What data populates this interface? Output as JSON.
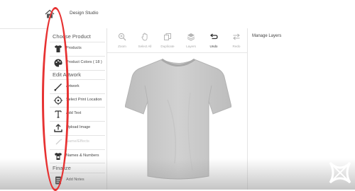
{
  "header": {
    "title": "Design Studio",
    "home_icon": "home-icon"
  },
  "sidebar": {
    "sections": {
      "choose_product": "Choose Product",
      "edit_artwork": "Edit Artwork",
      "finalize": "Finalize"
    },
    "items": [
      {
        "label": "Products",
        "icon": "tshirt-icon",
        "enabled": true
      },
      {
        "label": "Product Colors ( 18 )",
        "icon": "palette-icon",
        "enabled": true
      },
      {
        "label": "Artwork",
        "icon": "brush-icon",
        "enabled": true
      },
      {
        "label": "Select Print Location",
        "icon": "location-icon",
        "enabled": true
      },
      {
        "label": "Add Text",
        "icon": "text-icon",
        "enabled": true
      },
      {
        "label": "Upload Image",
        "icon": "upload-icon",
        "enabled": true
      },
      {
        "label": "Name/Effects",
        "icon": "magic-wand-icon",
        "enabled": false
      },
      {
        "label": "Names & Numbers",
        "icon": "jersey-icon",
        "enabled": true
      },
      {
        "label": "Add Notes",
        "icon": "notes-icon",
        "enabled": true
      }
    ]
  },
  "toolbar": {
    "tools": [
      {
        "label": "Zoom",
        "icon": "zoom-icon",
        "enabled": false
      },
      {
        "label": "Select All",
        "icon": "hand-icon",
        "enabled": false
      },
      {
        "label": "Duplicate",
        "icon": "duplicate-icon",
        "enabled": false
      },
      {
        "label": "Layers",
        "icon": "layers-icon",
        "enabled": false
      },
      {
        "label": "Undo",
        "icon": "undo-icon",
        "enabled": true
      },
      {
        "label": "Redo",
        "icon": "redo-icon",
        "enabled": false
      }
    ]
  },
  "canvas": {
    "product": "Gray T-Shirt",
    "product_color": "#c9c9c9"
  },
  "layers_panel": {
    "title": "Manage Layers"
  },
  "colors": {
    "annotation": "#e73232",
    "accent": "#333333"
  }
}
